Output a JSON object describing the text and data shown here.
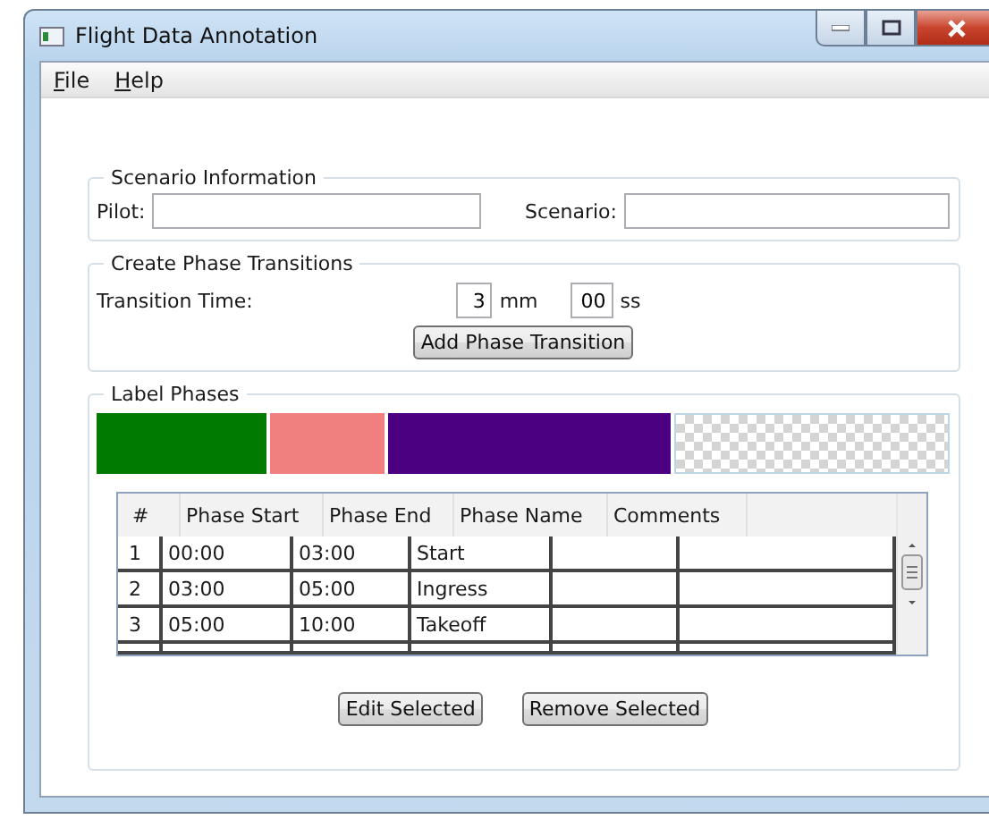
{
  "window": {
    "title": "Flight Data Annotation"
  },
  "menu": [
    {
      "label": "File"
    },
    {
      "label": "Help"
    }
  ],
  "scenario_information": {
    "title": "Scenario Information",
    "pilot_label": "Pilot:",
    "scenario_label": "Scenario:"
  },
  "create_phase_transitions": {
    "title": "Create Phase Transitions",
    "time_label": "Transition Time:",
    "minutes": "3",
    "minutes_unit": "mm",
    "seconds": "00",
    "seconds_unit": "ss",
    "button": "Add Phase Transition"
  },
  "label_phases": {
    "title": "Label Phases",
    "timeline": [
      {
        "kind": "phase",
        "color": "#007a00"
      },
      {
        "kind": "phase",
        "color": "#f08080"
      },
      {
        "kind": "phase",
        "color": "#4b0082"
      },
      {
        "kind": "empty"
      }
    ],
    "table": {
      "columns": [
        "#",
        "Phase Start",
        "Phase End",
        "Phase Name",
        "Comments"
      ],
      "rows": [
        [
          "1",
          "00:00",
          "03:00",
          "Start",
          ""
        ],
        [
          "2",
          "03:00",
          "05:00",
          "Ingress",
          ""
        ],
        [
          "3",
          "05:00",
          "10:00",
          "Takeoff",
          ""
        ]
      ]
    },
    "buttons": [
      "Edit Selected",
      "Remove Selected"
    ]
  }
}
